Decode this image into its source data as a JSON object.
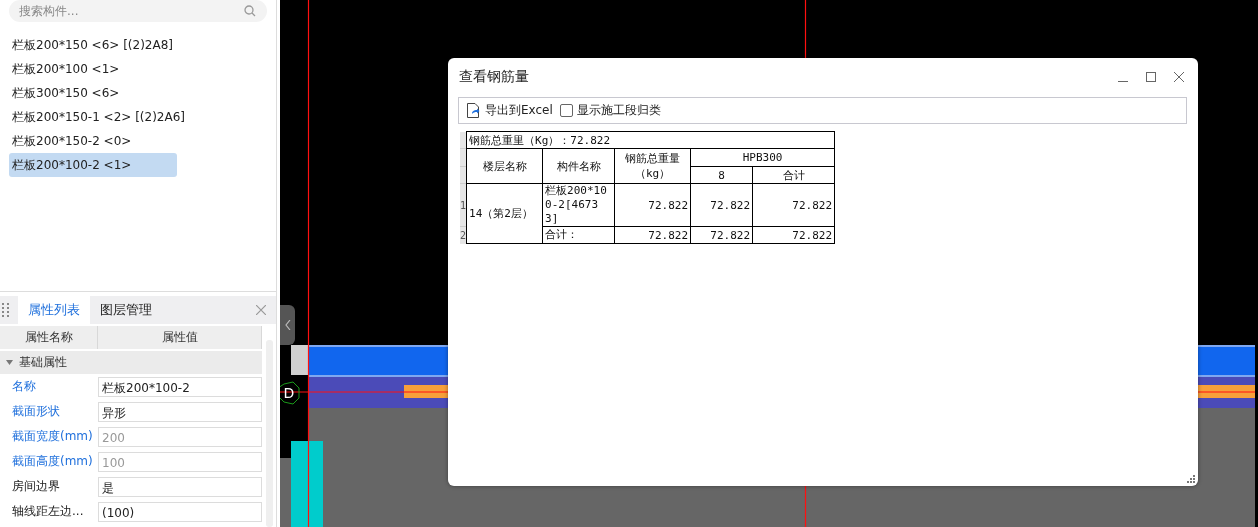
{
  "search": {
    "placeholder": "搜索构件..."
  },
  "components": [
    {
      "label": "栏板200*150 <6> [(2)2A8]",
      "selected": false
    },
    {
      "label": "栏板200*100 <1>",
      "selected": false
    },
    {
      "label": "栏板300*150 <6>",
      "selected": false
    },
    {
      "label": "栏板200*150-1 <2> [(2)2A6]",
      "selected": false
    },
    {
      "label": "栏板200*150-2 <0>",
      "selected": false
    },
    {
      "label": "栏板200*100-2 <1>",
      "selected": true
    }
  ],
  "properties": {
    "tabs": [
      {
        "label": "属性列表",
        "selected": true
      },
      {
        "label": "图层管理",
        "selected": false
      }
    ],
    "columns": [
      "属性名称",
      "属性值"
    ],
    "groups": [
      {
        "label": "基础属性",
        "expanded": true,
        "rows": [
          {
            "name": "名称",
            "value": "栏板200*100-2",
            "public": true,
            "disabled": false
          },
          {
            "name": "截面形状",
            "value": "异形",
            "public": true,
            "disabled": false
          },
          {
            "name": "截面宽度(mm)",
            "value": "200",
            "public": true,
            "disabled": true
          },
          {
            "name": "截面高度(mm)",
            "value": "100",
            "public": true,
            "disabled": true
          },
          {
            "name": "房间边界",
            "value": "是",
            "public": false,
            "disabled": false
          },
          {
            "name": "轴线距左边...",
            "value": "(100)",
            "public": false,
            "disabled": false
          }
        ]
      }
    ]
  },
  "canvas": {
    "axis_label": "D"
  },
  "dialog": {
    "title": "查看钢筋量",
    "toolbar": {
      "export_button": "导出到Excel",
      "checkbox": {
        "label": "显示施工段归类",
        "checked": false
      }
    },
    "table": {
      "summary": "钢筋总重里（Kg）：72.822",
      "columns": [
        "楼层名称",
        "构件名称",
        "钢筋总重量（kg）"
      ],
      "group": {
        "label": "HPB300",
        "columns": [
          "8",
          "合计"
        ]
      },
      "floor": "14（第2层）",
      "rows": [
        {
          "number": "1",
          "component": "栏板200*100-2[46733]",
          "values": [
            "72.822",
            "72.822",
            "72.822"
          ]
        },
        {
          "number": "2",
          "component": "合计：",
          "values": [
            "72.822",
            "72.822",
            "72.822"
          ]
        }
      ]
    }
  }
}
